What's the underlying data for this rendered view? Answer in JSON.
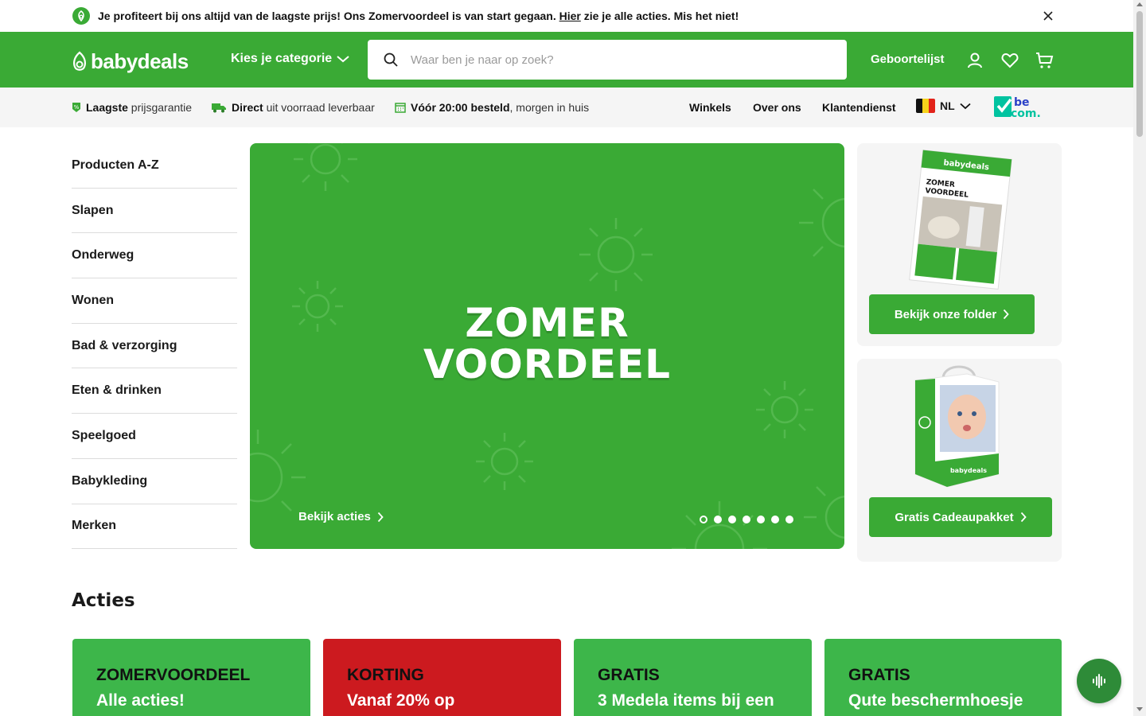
{
  "announcement": {
    "text_before": "Je profiteert bij ons altijd van de laagste prijs! Ons Zomervoordeel is van start gegaan. ",
    "link": "Hier",
    "text_after": " zie je alle acties. Mis het niet!",
    "icon": "leaf-icon",
    "close_icon": "close-icon"
  },
  "header": {
    "logo_text": "babydeals",
    "category_button": "Kies je categorie",
    "search_placeholder": "Waar ben je naar op zoek?",
    "birth_list": "Geboortelijst",
    "icons": [
      "account-icon",
      "heart-icon",
      "cart-icon"
    ]
  },
  "usp": {
    "items": [
      {
        "bold": "Laagste",
        "rest": " prijsgarantie",
        "icon": "price-tag-icon"
      },
      {
        "bold": "Direct",
        "rest": " uit voorraad leverbaar",
        "icon": "truck-icon"
      },
      {
        "bold": "Vóór 20:00 besteld",
        "rest": ", morgen in huis",
        "icon": "calendar-icon"
      }
    ],
    "nav": [
      "Winkels",
      "Over ons",
      "Klantendienst"
    ],
    "language": "NL",
    "partner_logo": "be com."
  },
  "sidebar": {
    "categories": [
      "Producten A-Z",
      "Slapen",
      "Onderweg",
      "Wonen",
      "Bad & verzorging",
      "Eten & drinken",
      "Speelgoed",
      "Babykleding",
      "Merken"
    ]
  },
  "hero": {
    "title_line1": "ZOMER",
    "title_line2": "VOORDEEL",
    "cta": "Bekijk acties",
    "slide_count": 7,
    "active_slide": 1
  },
  "promos": [
    {
      "button": "Bekijk onze folder",
      "image": "folder-image"
    },
    {
      "button": "Gratis Cadeaupakket",
      "image": "gift-bag-image"
    }
  ],
  "acties": {
    "title": "Acties",
    "cards": [
      {
        "tag": "ZOMERVOORDEEL",
        "sub": "Alle acties!",
        "color": "#3db64a"
      },
      {
        "tag": "KORTING",
        "sub": "Vanaf 20% op",
        "color": "#cc1a1f"
      },
      {
        "tag": "GRATIS",
        "sub": "3 Medela items bij een",
        "color": "#3db64a"
      },
      {
        "tag": "GRATIS",
        "sub": "Qute beschermhoesje",
        "color": "#3db64a"
      }
    ]
  },
  "colors": {
    "brand_green": "#3aaa35",
    "deal_green": "#3db64a",
    "deal_red": "#cc1a1f",
    "becom_teal": "#00c3a0",
    "becom_blue": "#2a3fc7"
  },
  "fab_icon": "voice-assistant-icon"
}
